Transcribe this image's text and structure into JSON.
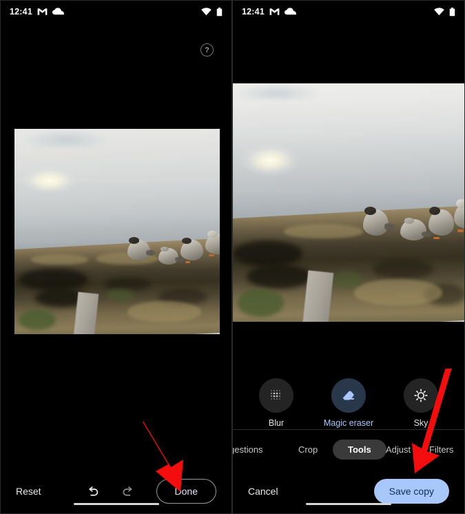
{
  "meta": {
    "accent_blue": "#a8c7fa",
    "arrow_red": "#f40d0d",
    "selected_tool_bg": "#28374a"
  },
  "status_bar": {
    "time": "12:41",
    "icons_left": [
      "gmail-icon",
      "cloud-icon"
    ],
    "icons_right": [
      "wifi-icon",
      "battery-icon"
    ]
  },
  "left_panel": {
    "help_label": "?",
    "photo_alt": "Geese standing on a lakeside shore with sun reflecting on water",
    "bottom_bar": {
      "reset_label": "Reset",
      "undo_icon": "undo-arrow-icon",
      "redo_icon": "redo-arrow-icon",
      "done_label": "Done"
    }
  },
  "right_panel": {
    "photo_alt": "Geese standing on a lakeside shore with sun reflecting on water, cropped view",
    "tools": [
      {
        "label": "Blur",
        "icon": "blur-dots-icon",
        "selected": false
      },
      {
        "label": "Magic eraser",
        "icon": "eraser-icon",
        "selected": true
      },
      {
        "label": "Sky",
        "icon": "sun-icon",
        "selected": false
      }
    ],
    "tabs": [
      {
        "label": "Suggestions",
        "active": false
      },
      {
        "label": "Crop",
        "active": false
      },
      {
        "label": "Tools",
        "active": true
      },
      {
        "label": "Adjust",
        "active": false
      },
      {
        "label": "Filters",
        "active": false
      }
    ],
    "bottom_bar": {
      "cancel_label": "Cancel",
      "save_label": "Save copy"
    }
  },
  "annotations": [
    {
      "name": "arrow-to-done",
      "target": "Done"
    },
    {
      "name": "arrow-to-save-copy",
      "target": "Save copy"
    }
  ]
}
